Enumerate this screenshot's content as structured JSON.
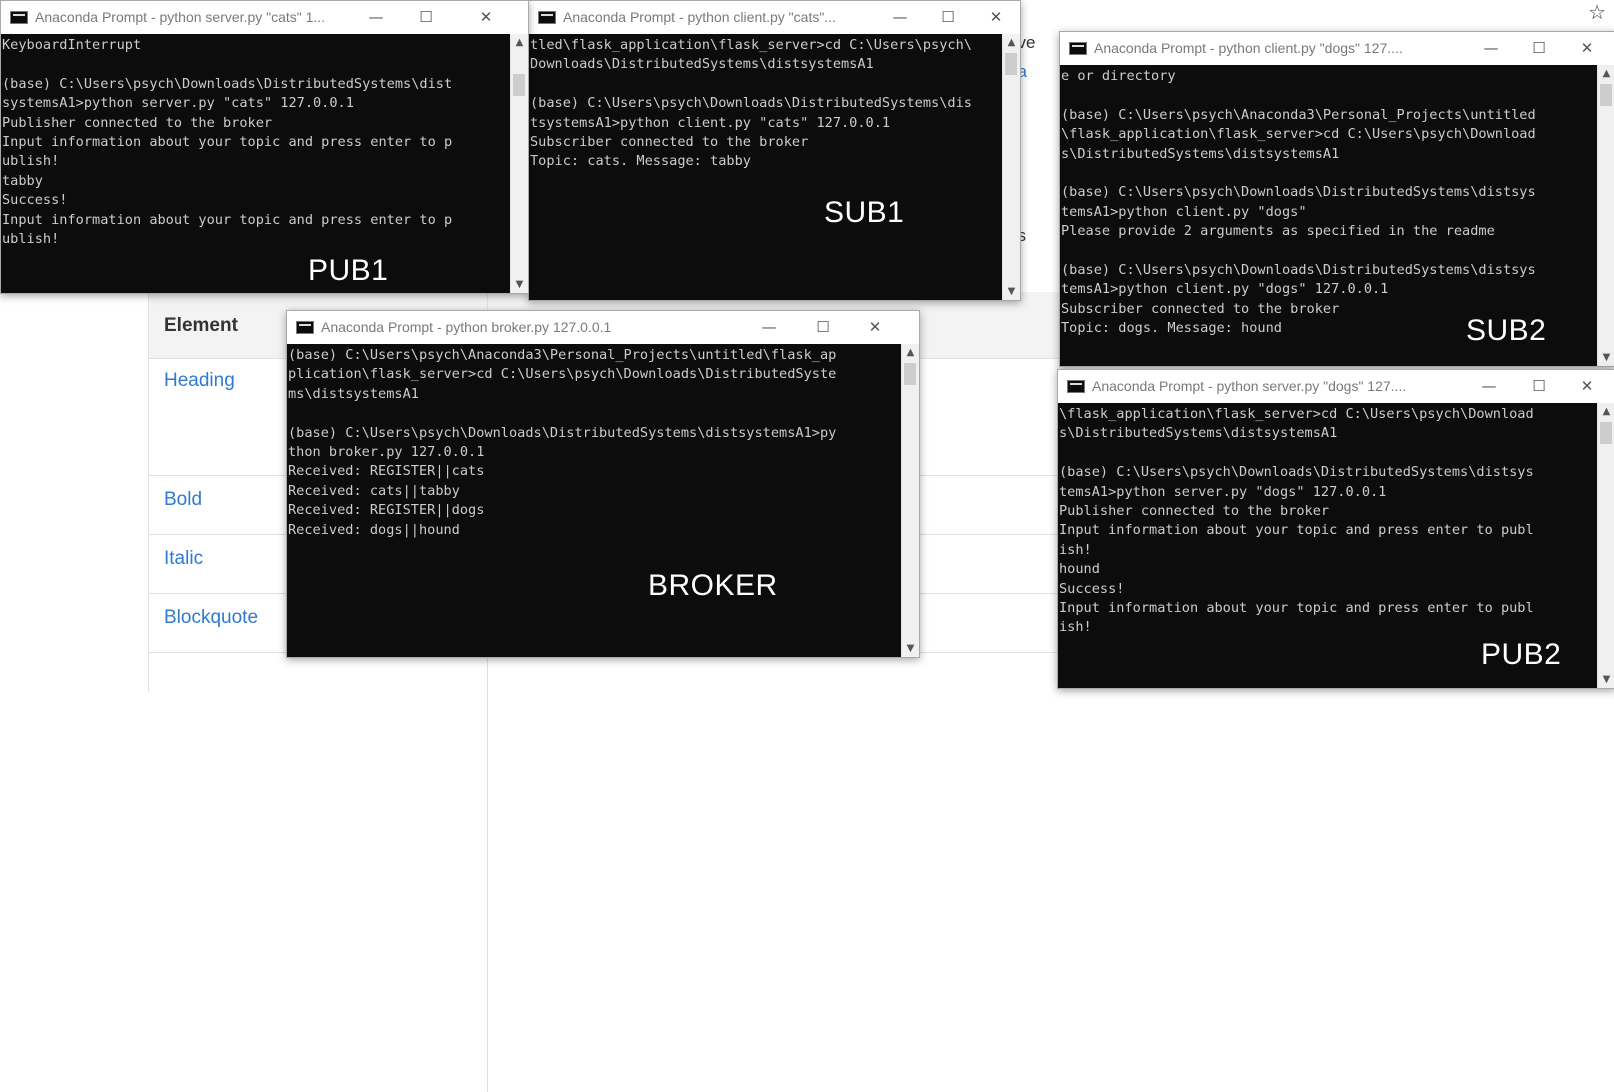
{
  "background": {
    "table_header": "Element",
    "rows": [
      "Heading",
      "Bold",
      "Italic",
      "Blockquote"
    ],
    "fragments": [
      "ove",
      "oa",
      "ns"
    ]
  },
  "icons": {
    "bookmark": "star-icon"
  },
  "windows": {
    "pub1": {
      "title": "Anaconda Prompt - python  server.py \"cats\" 1...",
      "label": "PUB1",
      "lines": [
        "KeyboardInterrupt",
        "",
        "(base) C:\\Users\\psych\\Downloads\\DistributedSystems\\dist",
        "systemsA1>python server.py \"cats\" 127.0.0.1",
        "Publisher connected to the broker",
        "Input information about your topic and press enter to p",
        "ublish!",
        "tabby",
        "Success!",
        "Input information about your topic and press enter to p",
        "ublish!"
      ]
    },
    "sub1": {
      "title": "Anaconda Prompt - python  client.py \"cats\"...",
      "label": "SUB1",
      "lines": [
        "tled\\flask_application\\flask_server>cd C:\\Users\\psych\\",
        "Downloads\\DistributedSystems\\distsystemsA1",
        "",
        "(base) C:\\Users\\psych\\Downloads\\DistributedSystems\\dis",
        "tsystemsA1>python client.py \"cats\" 127.0.0.1",
        "Subscriber connected to the broker",
        "Topic: cats. Message: tabby"
      ]
    },
    "sub2": {
      "title": "Anaconda Prompt - python  client.py \"dogs\" 127....",
      "label": "SUB2",
      "lines": [
        "e or directory",
        "",
        "(base) C:\\Users\\psych\\Anaconda3\\Personal_Projects\\untitled",
        "\\flask_application\\flask_server>cd C:\\Users\\psych\\Download",
        "s\\DistributedSystems\\distsystemsA1",
        "",
        "(base) C:\\Users\\psych\\Downloads\\DistributedSystems\\distsys",
        "temsA1>python client.py \"dogs\"",
        "Please provide 2 arguments as specified in the readme",
        "",
        "(base) C:\\Users\\psych\\Downloads\\DistributedSystems\\distsys",
        "temsA1>python client.py \"dogs\" 127.0.0.1",
        "Subscriber connected to the broker",
        "Topic: dogs. Message: hound"
      ]
    },
    "broker": {
      "title": "Anaconda Prompt - python  broker.py 127.0.0.1",
      "label": "BROKER",
      "lines": [
        "(base) C:\\Users\\psych\\Anaconda3\\Personal_Projects\\untitled\\flask_ap",
        "plication\\flask_server>cd C:\\Users\\psych\\Downloads\\DistributedSyste",
        "ms\\distsystemsA1",
        "",
        "(base) C:\\Users\\psych\\Downloads\\DistributedSystems\\distsystemsA1>py",
        "thon broker.py 127.0.0.1",
        "Received: REGISTER||cats",
        "Received: cats||tabby",
        "Received: REGISTER||dogs",
        "Received: dogs||hound"
      ]
    },
    "pub2": {
      "title": "Anaconda Prompt - python  server.py \"dogs\" 127....",
      "label": "PUB2",
      "lines": [
        "\\flask_application\\flask_server>cd C:\\Users\\psych\\Download",
        "s\\DistributedSystems\\distsystemsA1",
        "",
        "(base) C:\\Users\\psych\\Downloads\\DistributedSystems\\distsys",
        "temsA1>python server.py \"dogs\" 127.0.0.1",
        "Publisher connected to the broker",
        "Input information about your topic and press enter to publ",
        "ish!",
        "hound",
        "Success!",
        "Input information about your topic and press enter to publ",
        "ish!"
      ]
    }
  },
  "controls": {
    "minimize": "—",
    "maximize": "☐",
    "close": "✕"
  }
}
